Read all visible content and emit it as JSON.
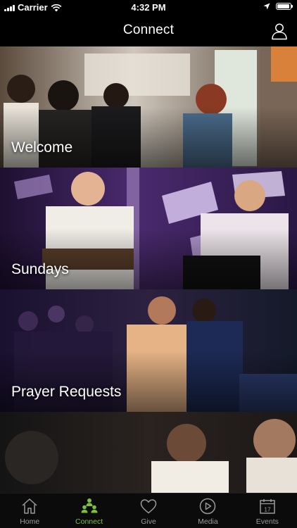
{
  "status_bar": {
    "carrier": "Carrier",
    "time": "4:32 PM",
    "battery_level": 0.95
  },
  "nav": {
    "title": "Connect",
    "profile_icon": "user-profile-icon"
  },
  "feed": {
    "tiles": [
      {
        "label": "Welcome"
      },
      {
        "label": "Sundays"
      },
      {
        "label": "Prayer Requests"
      },
      {
        "label": ""
      }
    ]
  },
  "tab_bar": {
    "active_color": "#7fbf3f",
    "inactive_color": "#9a9a9a",
    "tabs": [
      {
        "label": "Home",
        "icon": "home-icon"
      },
      {
        "label": "Connect",
        "icon": "connect-icon"
      },
      {
        "label": "Give",
        "icon": "heart-icon"
      },
      {
        "label": "Media",
        "icon": "play-icon"
      },
      {
        "label": "Events",
        "icon": "calendar-icon",
        "icon_text": "17"
      }
    ],
    "active_index": 1
  }
}
